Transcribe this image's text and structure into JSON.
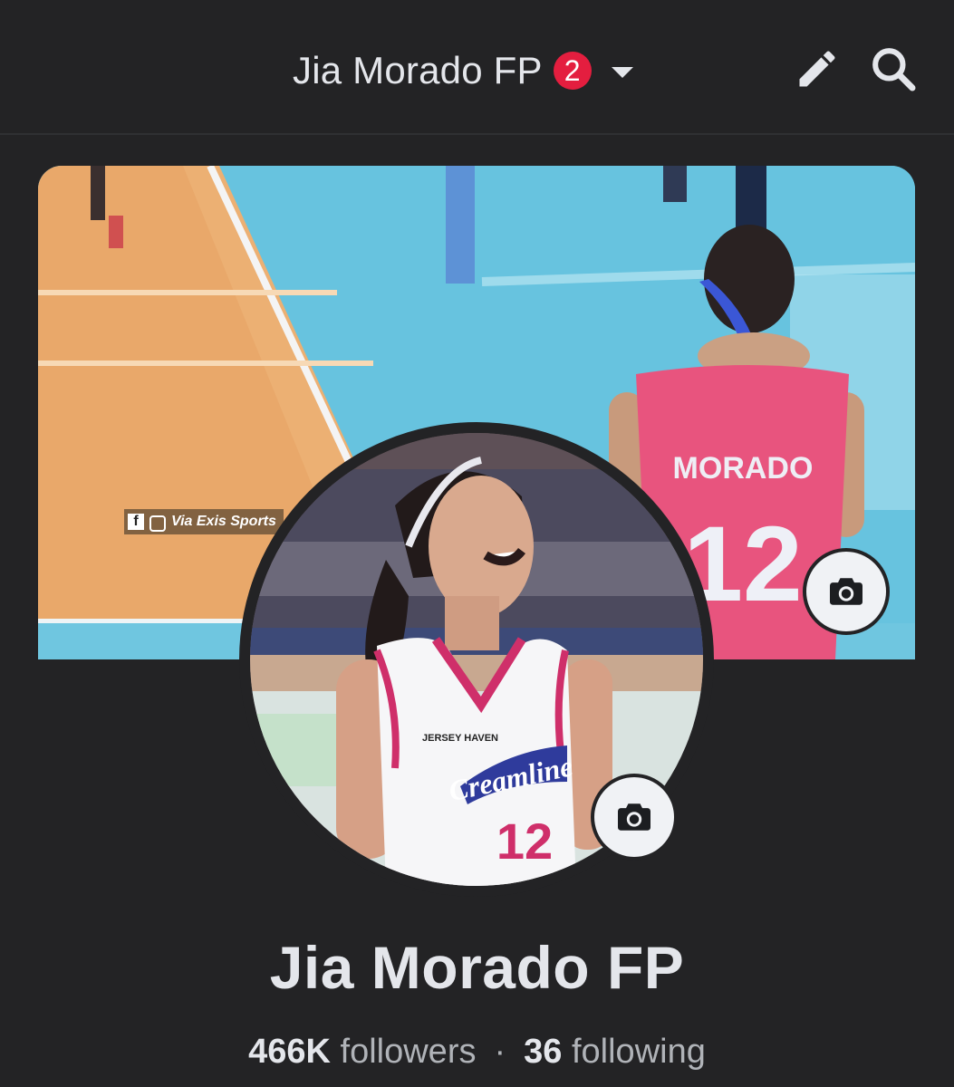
{
  "header": {
    "page_title": "Jia Morado FP",
    "notification_count": "2",
    "edit_icon": "pencil-icon",
    "search_icon": "search-icon"
  },
  "cover": {
    "watermark": "Via Exis Sports",
    "jersey_name": "MORADO",
    "jersey_number": "12",
    "camera_icon": "camera-icon"
  },
  "avatar": {
    "jersey_brand": "Creamline",
    "jersey_number": "12",
    "sponsor": "JERSEY HAVEN",
    "camera_icon": "camera-icon"
  },
  "profile": {
    "name": "Jia Morado FP",
    "followers_count": "466K",
    "followers_label": "followers",
    "separator": "·",
    "following_count": "36",
    "following_label": "following"
  },
  "colors": {
    "background": "#232325",
    "badge": "#e41e3f",
    "text": "#e4e6eb",
    "muted": "#b0b3b8"
  }
}
